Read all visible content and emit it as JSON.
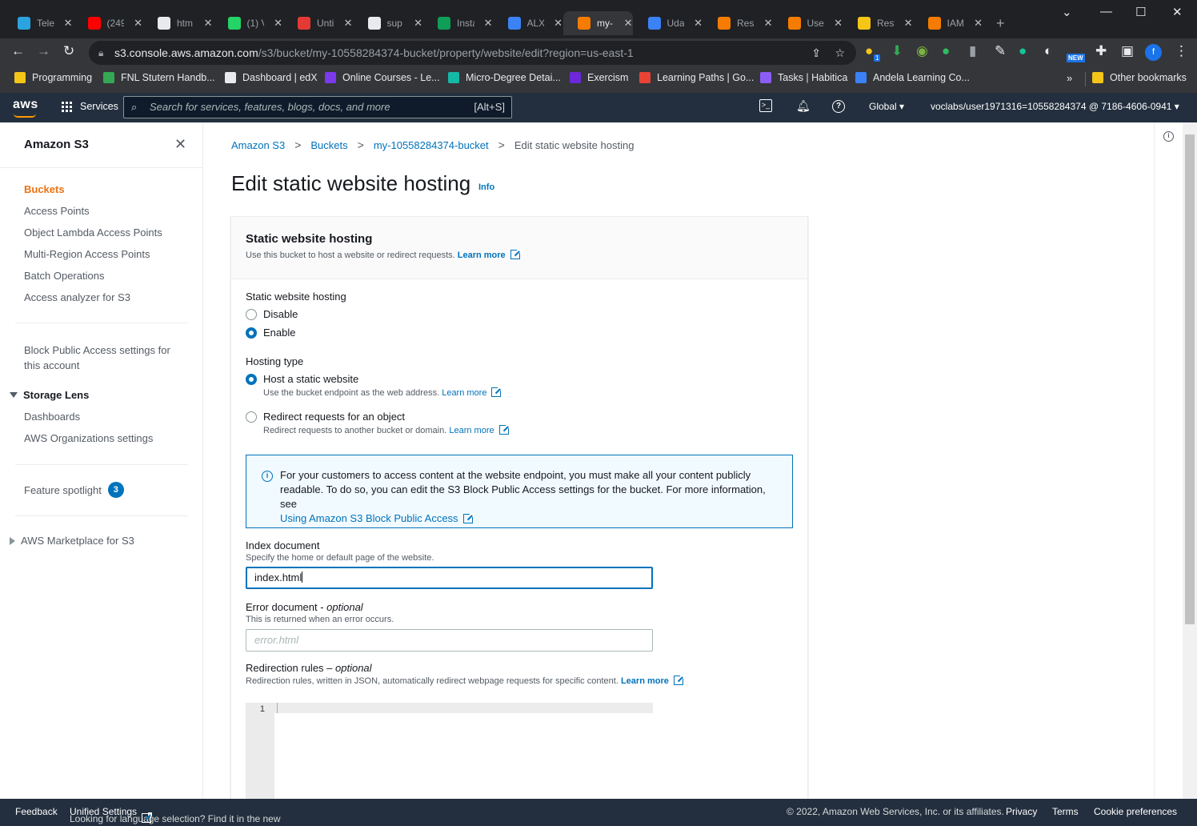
{
  "browser": {
    "tabs": [
      {
        "title": "Tele",
        "color": "#2aa3df"
      },
      {
        "title": "(249",
        "color": "#ff0000"
      },
      {
        "title": "htm",
        "color": "#e8eaed"
      },
      {
        "title": "(1) V",
        "color": "#25d366"
      },
      {
        "title": "Unti",
        "color": "#e53935"
      },
      {
        "title": "sup",
        "color": "#e8eaed"
      },
      {
        "title": "Insta",
        "color": "#0f9d58"
      },
      {
        "title": "ALX",
        "color": "#3b82f6"
      },
      {
        "title": "my-",
        "color": "#f57c00"
      },
      {
        "title": "Uda",
        "color": "#3b82f6"
      },
      {
        "title": "Res",
        "color": "#f57c00"
      },
      {
        "title": "Use",
        "color": "#f57c00"
      },
      {
        "title": "Rest",
        "color": "#f5c518"
      },
      {
        "title": "IAM",
        "color": "#f57c00"
      }
    ],
    "url_host": "s3.console.aws.amazon.com",
    "url_path": "/s3/bucket/my-10558284374-bucket/property/website/edit?region=us-east-1",
    "bookmarks": [
      {
        "label": "Programming",
        "color": "#f5c518"
      },
      {
        "label": "FNL Stutern Handb...",
        "color": "#34a853"
      },
      {
        "label": "Dashboard | edX",
        "color": "#e8eaed"
      },
      {
        "label": "Online Courses - Le...",
        "color": "#7c3aed"
      },
      {
        "label": "Micro-Degree Detai...",
        "color": "#14b8a6"
      },
      {
        "label": "Exercism",
        "color": "#6d28d9"
      },
      {
        "label": "Learning Paths | Go...",
        "color": "#ea4335"
      },
      {
        "label": "Tasks | Habitica",
        "color": "#8b5cf6"
      },
      {
        "label": "Andela Learning Co...",
        "color": "#3b82f6"
      }
    ],
    "other_bookmarks": "Other bookmarks",
    "profile_initial": "f",
    "new_badge": "NEW",
    "ext_count": "1"
  },
  "aws_nav": {
    "logo": "aws",
    "services": "Services",
    "search_placeholder": "Search for services, features, blogs, docs, and more",
    "search_shortcut": "[Alt+S]",
    "region": "Global",
    "account": "voclabs/user1971316=10558284374 @ 7186-4606-0941"
  },
  "sidebar": {
    "title": "Amazon S3",
    "items": [
      "Buckets",
      "Access Points",
      "Object Lambda Access Points",
      "Multi-Region Access Points",
      "Batch Operations",
      "Access analyzer for S3"
    ],
    "block_public_line1": "Block Public Access settings for",
    "block_public_line2": "this account",
    "storage_lens": "Storage Lens",
    "storage_lens_items": [
      "Dashboards",
      "AWS Organizations settings"
    ],
    "feature_spotlight": "Feature spotlight",
    "feature_count": "3",
    "marketplace": "AWS Marketplace for S3"
  },
  "breadcrumb": [
    "Amazon S3",
    "Buckets",
    "my-10558284374-bucket",
    "Edit static website hosting"
  ],
  "page": {
    "title": "Edit static website hosting",
    "info": "Info"
  },
  "panel": {
    "title": "Static website hosting",
    "desc": "Use this bucket to host a website or redirect requests.",
    "learn_more": "Learn more",
    "hosting_label": "Static website hosting",
    "disable": "Disable",
    "enable": "Enable",
    "hosting_type": "Hosting type",
    "host_static": "Host a static website",
    "host_static_desc": "Use the bucket endpoint as the web address.",
    "redirect": "Redirect requests for an object",
    "redirect_desc": "Redirect requests to another bucket or domain.",
    "alert_text": "For your customers to access content at the website endpoint, you must make all your content publicly readable. To do so, you can edit the S3 Block Public Access settings for the bucket. For more information, see",
    "alert_link": "Using Amazon S3 Block Public Access",
    "index_label": "Index document",
    "index_desc": "Specify the home or default page of the website.",
    "index_value": "index.html",
    "error_label": "Error document - ",
    "error_optional": "optional",
    "error_desc": "This is returned when an error occurs.",
    "error_placeholder": "error.html",
    "redir_label": "Redirection rules – ",
    "redir_optional": "optional",
    "redir_desc": "Redirection rules, written in JSON, automatically redirect webpage requests for specific content.",
    "line_number": "1"
  },
  "footer": {
    "feedback": "Feedback",
    "lang_text": "Looking for language selection? Find it in the new",
    "unified": "Unified Settings",
    "copyright": "© 2022, Amazon Web Services, Inc. or its affiliates.",
    "privacy": "Privacy",
    "terms": "Terms",
    "cookie": "Cookie preferences"
  }
}
